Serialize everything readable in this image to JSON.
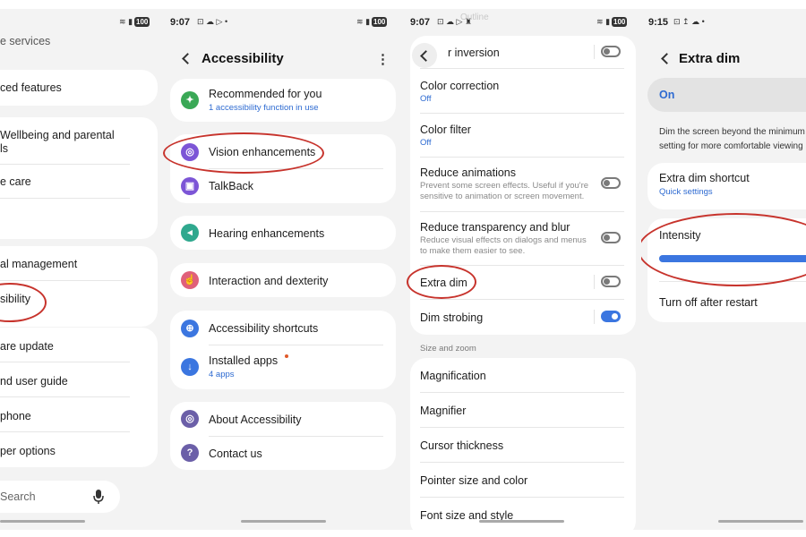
{
  "colors": {
    "accent": "#3b76e0",
    "link": "#2d6ad1",
    "annotation": "#c7332c",
    "background": "#f3f3f3",
    "card": "#ffffff"
  },
  "panel1": {
    "items": [
      "e services",
      "ced features",
      "Wellbeing and parental",
      "ls",
      "e care",
      "al management",
      "sibility",
      "are update",
      "nd user guide",
      "phone",
      "per options"
    ],
    "search_placeholder": "Search"
  },
  "panel2": {
    "time": "9:07",
    "status_left_icons": "⊡ ☁ ▷ •",
    "battery": "100",
    "title": "Accessibility",
    "items": [
      {
        "label": "Recommended for you",
        "sub": "1 accessibility function in use",
        "icon": "accessibility-icon",
        "color": "#3aa856"
      },
      {
        "label": "Vision enhancements",
        "icon": "magnifier-icon",
        "color": "#7c55d6"
      },
      {
        "label": "TalkBack",
        "icon": "talkback-icon",
        "color": "#7c55d6"
      },
      {
        "label": "Hearing enhancements",
        "icon": "hearing-icon",
        "color": "#2fa88e"
      },
      {
        "label": "Interaction and dexterity",
        "icon": "touch-icon",
        "color": "#e0607a"
      },
      {
        "label": "Accessibility shortcuts",
        "icon": "shortcut-icon",
        "color": "#3b76e0"
      },
      {
        "label": "Installed apps",
        "sub": "4 apps",
        "icon": "apps-icon",
        "color": "#3b76e0"
      },
      {
        "label": "About Accessibility",
        "icon": "about-icon",
        "color": "#6b5fa8"
      },
      {
        "label": "Contact us",
        "icon": "help-icon",
        "color": "#6b5fa8"
      }
    ]
  },
  "panel3": {
    "time": "9:07",
    "status_left_icons": "⊡ ☁ ▷ ♜",
    "battery": "100",
    "top_faded": "Outline",
    "items": [
      {
        "label": "r inversion"
      },
      {
        "label": "Color correction",
        "sub": "Off"
      },
      {
        "label": "Color filter",
        "sub": "Off"
      },
      {
        "label": "Reduce animations",
        "desc": "Prevent some screen effects. Useful if you're sensitive to animation or screen movement."
      },
      {
        "label": "Reduce transparency and blur",
        "desc": "Reduce visual effects on dialogs and menus to make them easier to see."
      },
      {
        "label": "Extra dim"
      },
      {
        "label": "Dim strobing"
      }
    ],
    "section_label": "Size and zoom",
    "size_items": [
      "Magnification",
      "Magnifier",
      "Cursor thickness",
      "Pointer size and color",
      "Font size and style"
    ]
  },
  "panel4": {
    "time": "9:15",
    "status_left_icons": "⊡ ↥ ☁ •",
    "title": "Extra dim",
    "on_label": "On",
    "desc": "Dim the screen beyond the minimum setting for more comfortable viewing",
    "shortcut_label": "Extra dim shortcut",
    "shortcut_sub": "Quick settings",
    "intensity_label": "Intensity",
    "intensity_value": 1.0,
    "restart_label": "Turn off after restart"
  }
}
